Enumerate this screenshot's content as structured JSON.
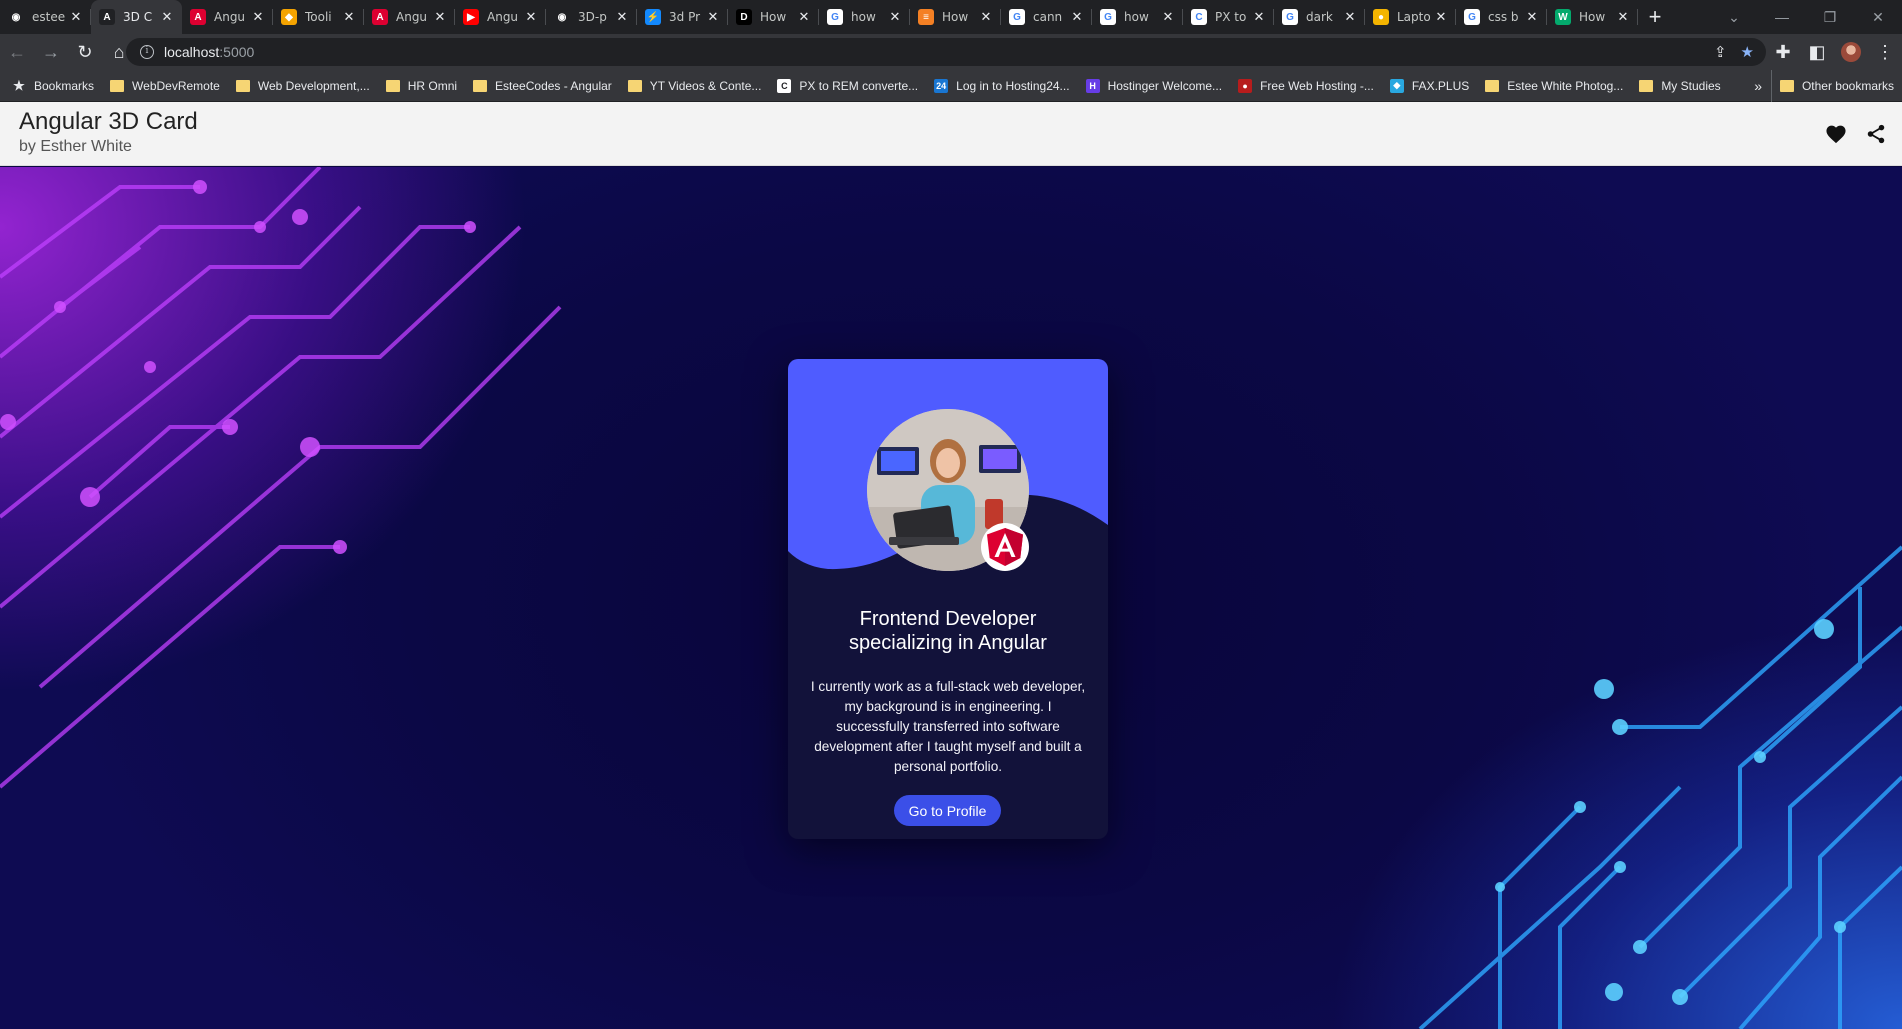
{
  "browser": {
    "tabs": [
      {
        "title": "estee",
        "icon": "github-icon",
        "color": "#202124"
      },
      {
        "title": "3D C",
        "icon": "angular-icon",
        "color": "#202124",
        "active": true
      },
      {
        "title": "Angu",
        "icon": "angular-icon",
        "color": "#dd0031"
      },
      {
        "title": "Tooli",
        "icon": "shield-icon",
        "color": "#f4a300"
      },
      {
        "title": "Angu",
        "icon": "angular-icon",
        "color": "#dd0031"
      },
      {
        "title": "Angu",
        "icon": "youtube-icon",
        "color": "#ff0000"
      },
      {
        "title": "3D-p",
        "icon": "github-icon",
        "color": "#202124"
      },
      {
        "title": "3d Pr",
        "icon": "stackblitz-icon",
        "color": "#1389fd"
      },
      {
        "title": "How",
        "icon": "dev-icon",
        "color": "#000000"
      },
      {
        "title": "how",
        "icon": "google-icon",
        "color": "#ffffff"
      },
      {
        "title": "How",
        "icon": "stackoverflow-icon",
        "color": "#f48024"
      },
      {
        "title": "cann",
        "icon": "google-icon",
        "color": "#ffffff"
      },
      {
        "title": "how",
        "icon": "google-icon",
        "color": "#ffffff"
      },
      {
        "title": "PX to",
        "icon": "c-icon",
        "color": "#ffffff"
      },
      {
        "title": "dark",
        "icon": "google-icon",
        "color": "#ffffff"
      },
      {
        "title": "Lapto",
        "icon": "globe-icon",
        "color": "#f4b400"
      },
      {
        "title": "css b",
        "icon": "google-icon",
        "color": "#ffffff"
      },
      {
        "title": "How",
        "icon": "w-icon",
        "color": "#04aa6d"
      }
    ],
    "url_host": "localhost",
    "url_port": ":5000",
    "bookmarks": [
      {
        "label": "Bookmarks",
        "icon": "star-icon"
      },
      {
        "label": "WebDevRemote",
        "icon": "folder-icon"
      },
      {
        "label": "Web Development,...",
        "icon": "folder-icon"
      },
      {
        "label": "HR Omni",
        "icon": "folder-icon"
      },
      {
        "label": "EsteeCodes - Angular",
        "icon": "folder-icon"
      },
      {
        "label": "YT Videos & Conte...",
        "icon": "folder-icon"
      },
      {
        "label": "PX to REM converte...",
        "icon": "c-icon"
      },
      {
        "label": "Log in to Hosting24...",
        "icon": "hosting24-icon"
      },
      {
        "label": "Hostinger Welcome...",
        "icon": "hostinger-icon"
      },
      {
        "label": "Free Web Hosting -...",
        "icon": "webhosting-icon"
      },
      {
        "label": "FAX.PLUS",
        "icon": "fax-icon"
      },
      {
        "label": "Estee White Photog...",
        "icon": "folder-icon"
      },
      {
        "label": "My Studies",
        "icon": "folder-icon"
      }
    ],
    "other_bookmarks": "Other bookmarks"
  },
  "header": {
    "title": "Angular 3D Card",
    "subtitle": "by Esther White"
  },
  "card": {
    "title": "Frontend Developer specializing in Angular",
    "description": "I currently work as a full-stack web developer, my background is in engineering. I successfully transferred into software development after I taught myself and built a personal portfolio.",
    "button_label": "Go to Profile",
    "accent_color": "#4f5cff",
    "button_color": "#3b4fe8"
  }
}
